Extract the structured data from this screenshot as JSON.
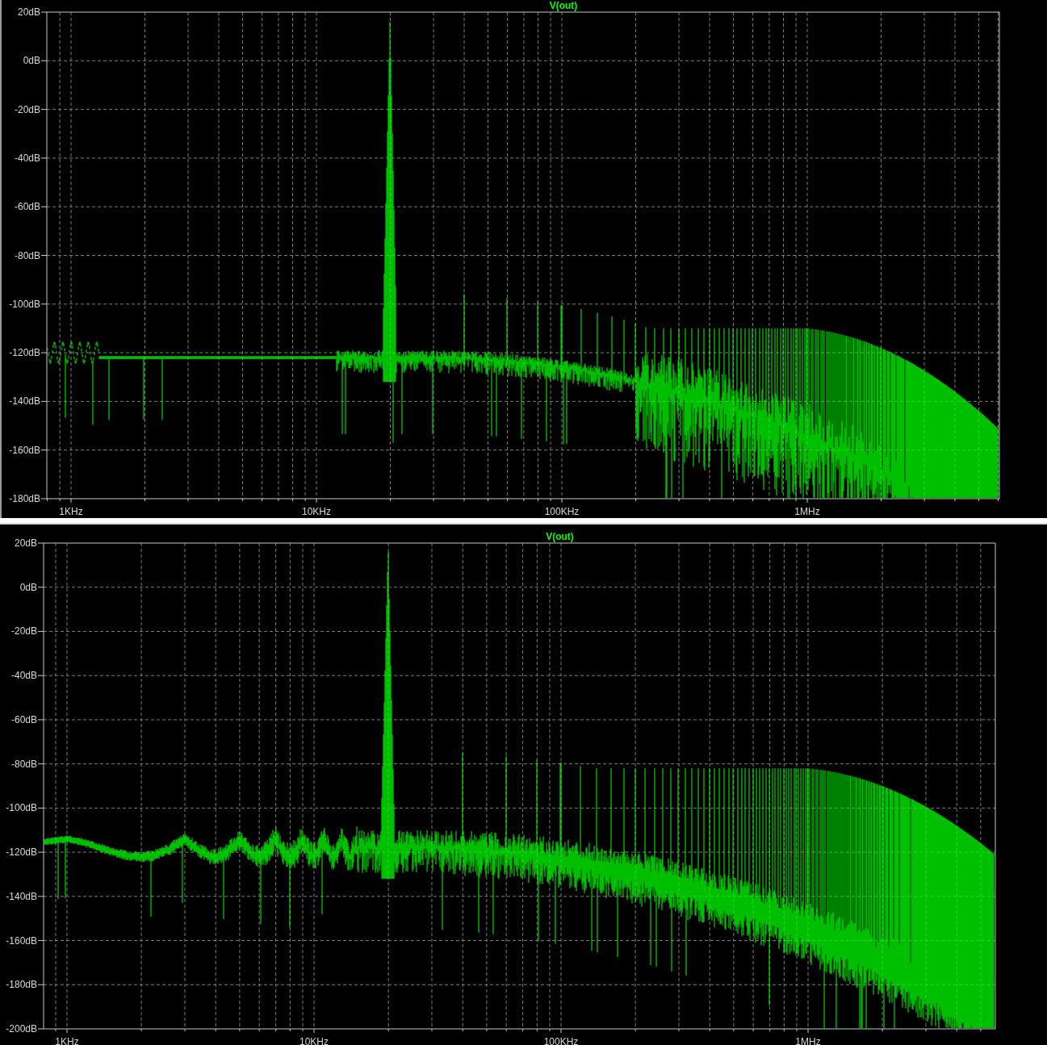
{
  "panels": [
    {
      "title": "V(out)",
      "y_ticks": [
        "20dB",
        "0dB",
        "-20dB",
        "-40dB",
        "-60dB",
        "-80dB",
        "-100dB",
        "-120dB",
        "-140dB",
        "-160dB",
        "-180dB"
      ],
      "x_ticks": [
        "1KHz",
        "10KHz",
        "100KHz",
        "1MHz"
      ]
    },
    {
      "title": "V(out)",
      "y_ticks": [
        "20dB",
        "0dB",
        "-20dB",
        "-40dB",
        "-60dB",
        "-80dB",
        "-100dB",
        "-120dB",
        "-140dB",
        "-160dB",
        "-180dB",
        "-200dB"
      ],
      "x_ticks": [
        "1KHz",
        "10KHz",
        "100KHz",
        "1MHz"
      ]
    }
  ]
}
